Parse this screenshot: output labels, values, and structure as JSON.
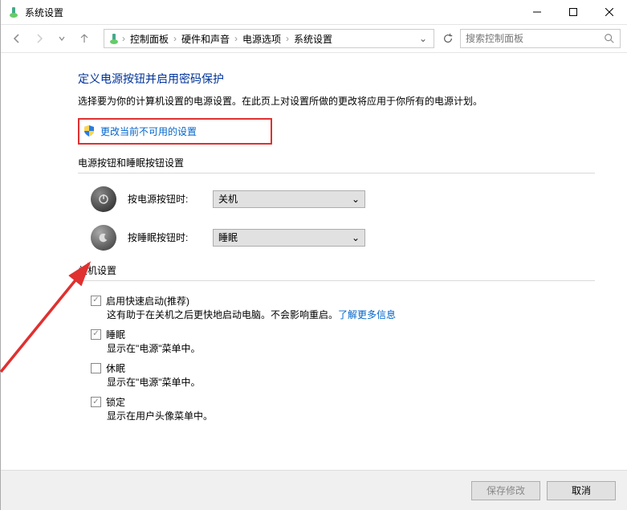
{
  "titlebar": {
    "title": "系统设置"
  },
  "breadcrumbs": {
    "items": [
      "控制面板",
      "硬件和声音",
      "电源选项",
      "系统设置"
    ]
  },
  "search": {
    "placeholder": "搜索控制面板"
  },
  "main": {
    "heading": "定义电源按钮并启用密码保护",
    "subtext": "选择要为你的计算机设置的电源设置。在此页上对设置所做的更改将应用于你所有的电源计划。",
    "change_link": "更改当前不可用的设置"
  },
  "buttons_section": {
    "title": "电源按钮和睡眠按钮设置",
    "rows": [
      {
        "label": "按电源按钮时:",
        "value": "关机"
      },
      {
        "label": "按睡眠按钮时:",
        "value": "睡眠"
      }
    ]
  },
  "shutdown_section": {
    "title": "关机设置",
    "items": [
      {
        "checked": true,
        "label": "启用快速启动(推荐)",
        "desc_prefix": "这有助于在关机之后更快地启动电脑。不会影响重启。",
        "desc_link": "了解更多信息"
      },
      {
        "checked": true,
        "label": "睡眠",
        "desc": "显示在\"电源\"菜单中。"
      },
      {
        "checked": false,
        "label": "休眠",
        "desc": "显示在\"电源\"菜单中。"
      },
      {
        "checked": true,
        "label": "锁定",
        "desc": "显示在用户头像菜单中。"
      }
    ]
  },
  "footer": {
    "save": "保存修改",
    "cancel": "取消"
  }
}
